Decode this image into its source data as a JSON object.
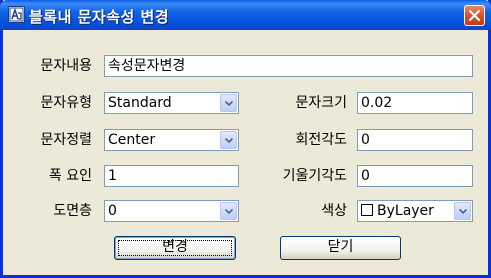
{
  "window": {
    "title": "블록내 문자속성 변경"
  },
  "fields": {
    "text_content": {
      "label": "문자내용",
      "value": "속성문자변경"
    },
    "text_style": {
      "label": "문자유형",
      "value": "Standard"
    },
    "text_size": {
      "label": "문자크기",
      "value": "0.02"
    },
    "text_align": {
      "label": "문자정렬",
      "value": "Center"
    },
    "rotation": {
      "label": "회전각도",
      "value": "0"
    },
    "width_factor": {
      "label": "폭 요인",
      "value": "1"
    },
    "oblique": {
      "label": "기울기각도",
      "value": "0"
    },
    "layer": {
      "label": "도면층",
      "value": "0"
    },
    "color": {
      "label": "색상",
      "value": "ByLayer"
    }
  },
  "buttons": {
    "change": "변경",
    "close": "닫기"
  }
}
